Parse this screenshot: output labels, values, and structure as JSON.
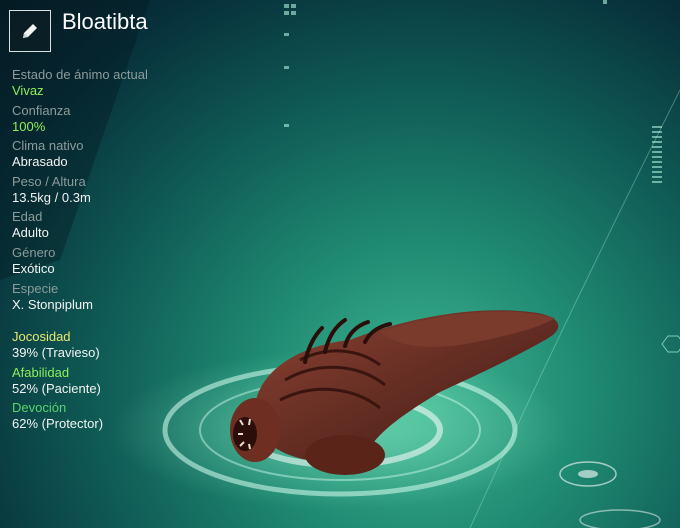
{
  "pet": {
    "name": "Bloatibta"
  },
  "edit": {
    "icon": "pencil-icon"
  },
  "stats": [
    {
      "label": "Estado de ánimo actual",
      "value": "Vivaz",
      "highlight": true
    },
    {
      "label": "Confianza",
      "value": "100%",
      "highlight": true
    },
    {
      "label": "Clima nativo",
      "value": "Abrasado",
      "highlight": false
    },
    {
      "label": "Peso / Altura",
      "value": "13.5kg / 0.3m",
      "highlight": false
    },
    {
      "label": "Edad",
      "value": "Adulto",
      "highlight": false
    },
    {
      "label": "Género",
      "value": "Exótico",
      "highlight": false
    },
    {
      "label": "Especie",
      "value": "X. Stonpiplum",
      "highlight": false
    }
  ],
  "traits": [
    {
      "label": "Jocosidad",
      "value": "39% (Travieso)",
      "color": "#e8e870"
    },
    {
      "label": "Afabilidad",
      "value": "52% (Paciente)",
      "color": "#8cef5a"
    },
    {
      "label": "Devoción",
      "value": "62% (Protector)",
      "color": "#5ad46a"
    }
  ],
  "colors": {
    "background": "#0f5a55",
    "accent": "#3fb592",
    "creature": "#6b2f24"
  }
}
